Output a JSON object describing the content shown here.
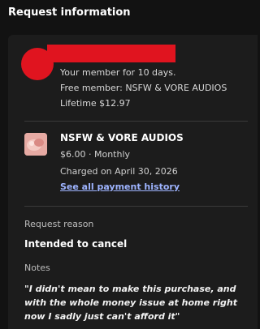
{
  "header": {
    "title": "Request information"
  },
  "member": {
    "duration_text": "Your member for 10 days.",
    "membership_text": "Free member: NSFW & VORE AUDIOS",
    "lifetime_text": "Lifetime $12.97",
    "avatar_color": "#e0141f"
  },
  "product": {
    "name": "NSFW & VORE AUDIOS",
    "price_text": "$6.00 · Monthly",
    "charged_text": "Charged on April 30, 2026",
    "history_link": "See all payment history",
    "link_color": "#9eb4ff"
  },
  "request": {
    "reason_label": "Request reason",
    "reason_value": "Intended to cancel",
    "notes_label": "Notes",
    "notes_value": "\"I didn't mean to make this purchase, and with the whole money issue at home right now I sadly just can't afford it\""
  }
}
